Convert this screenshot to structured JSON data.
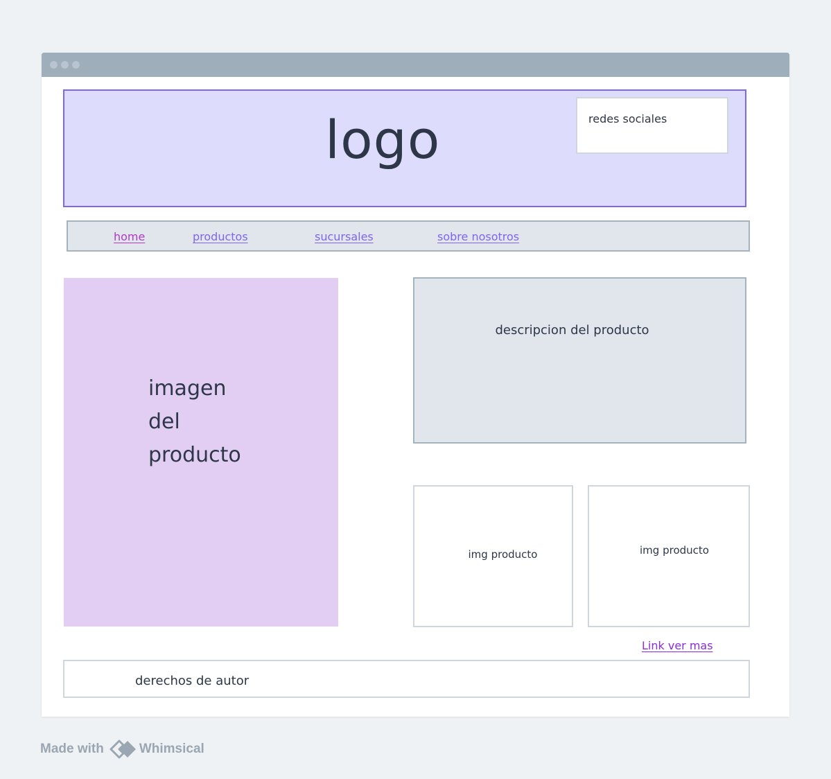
{
  "header": {
    "logo": "logo",
    "social": "redes sociales"
  },
  "nav": {
    "items": [
      "home",
      "productos",
      "sucursales",
      "sobre nosotros"
    ]
  },
  "main": {
    "image_text": "imagen\ndel\nproducto",
    "description": "descripcion del producto",
    "thumbnails": [
      "img producto",
      "img producto"
    ],
    "more_link": "Link ver mas"
  },
  "footer": {
    "text": "derechos de autor"
  },
  "watermark": {
    "made_with": "Made with",
    "brand": "Whimsical",
    "brand_icon": "whimsical-logo"
  },
  "colors": {
    "header_fill": "#dedcfd",
    "header_border": "#7b68ee",
    "image_fill": "#e2cef3",
    "panel_fill": "#e1e5ec",
    "link_home": "#b03ac7",
    "link_nav": "#7b68ee",
    "link_more": "#8a2be2"
  }
}
